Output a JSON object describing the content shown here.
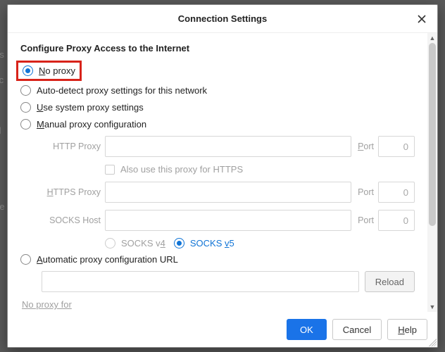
{
  "dialog": {
    "title": "Connection Settings",
    "section_heading": "Configure Proxy Access to the Internet"
  },
  "radios": {
    "no_proxy": "No proxy",
    "auto_detect": "Auto-detect proxy settings for this network",
    "use_system": "Use system proxy settings",
    "manual": "Manual proxy configuration",
    "auto_pac": "Automatic proxy configuration URL"
  },
  "labels": {
    "http_proxy": "HTTP Proxy",
    "https_proxy": "HTTPS Proxy",
    "socks_host": "SOCKS Host",
    "port": "Port",
    "also_https": "Also use this proxy for HTTPS",
    "socks_v4": "SOCKS v4",
    "socks_v5": "SOCKS v5",
    "reload": "Reload",
    "no_proxy_for": "No proxy for"
  },
  "values": {
    "http_proxy": "",
    "http_port": "0",
    "https_proxy": "",
    "https_port": "0",
    "socks_host": "",
    "socks_port": "0",
    "pac_url": ""
  },
  "buttons": {
    "ok": "OK",
    "cancel": "Cancel",
    "help": "Help"
  },
  "underline_chars": {
    "no_proxy_first": "N",
    "no_proxy_rest": "o proxy",
    "use_system_first": "U",
    "use_system_rest": "se system proxy settings",
    "manual_first": "M",
    "manual_rest": "anual proxy configuration",
    "auto_pac_first": "A",
    "auto_pac_rest": "utomatic proxy configuration URL",
    "https_first": "H",
    "https_rest": "TTPS Proxy",
    "help_first": "H",
    "help_rest": "elp",
    "port_first": "P",
    "port_rest": "ort",
    "v4_pre": "SOCKS v",
    "v4_num": "4",
    "v5_pre": "SOCKS ",
    "v5_und": "v",
    "v5_num": "5",
    "noproxy_first": "N",
    "noproxy_rest": "o proxy for"
  }
}
